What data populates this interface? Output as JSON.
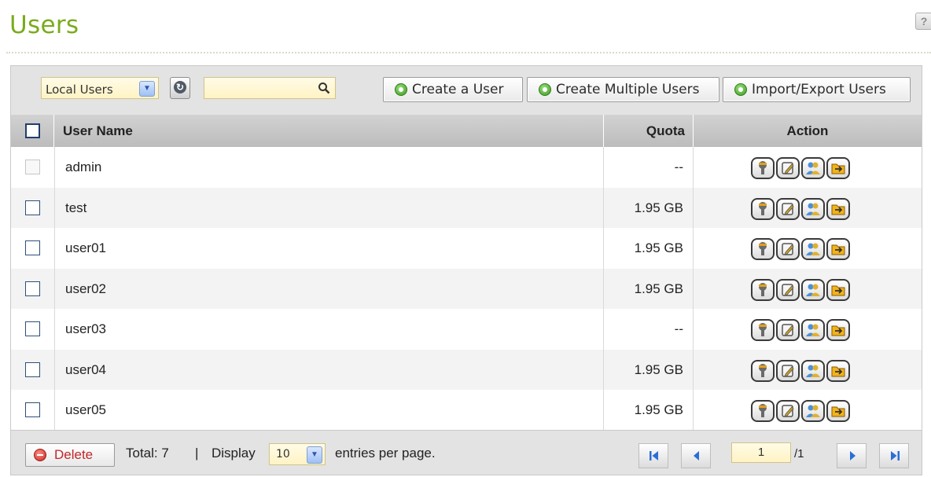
{
  "page": {
    "title": "Users",
    "help_icon": "?"
  },
  "toolbar": {
    "user_type_select": "Local Users",
    "refresh_icon": "refresh-icon",
    "search_placeholder": "",
    "create_user_label": "Create a User",
    "create_multiple_label": "Create Multiple Users",
    "import_export_label": "Import/Export Users"
  },
  "table": {
    "columns": {
      "name": "User Name",
      "quota": "Quota",
      "action": "Action"
    },
    "rows": [
      {
        "name": "admin",
        "quota": "--",
        "checkbox_enabled": false
      },
      {
        "name": "test",
        "quota": "1.95 GB",
        "checkbox_enabled": true
      },
      {
        "name": "user01",
        "quota": "1.95 GB",
        "checkbox_enabled": true
      },
      {
        "name": "user02",
        "quota": "1.95 GB",
        "checkbox_enabled": true
      },
      {
        "name": "user03",
        "quota": "--",
        "checkbox_enabled": true
      },
      {
        "name": "user04",
        "quota": "1.95 GB",
        "checkbox_enabled": true
      },
      {
        "name": "user05",
        "quota": "1.95 GB",
        "checkbox_enabled": true
      }
    ],
    "action_icons": [
      "password-key-icon",
      "edit-profile-icon",
      "user-group-icon",
      "edit-folder-permission-icon"
    ]
  },
  "footer": {
    "delete_label": "Delete",
    "total_label": "Total:",
    "total_count": "7",
    "separator": "|",
    "display_label": "Display",
    "page_size": "10",
    "per_page_label": "entries per page.",
    "current_page": "1",
    "total_pages": "/1"
  },
  "colors": {
    "title_green": "#7aab1d",
    "header_gray": "#c4c4c4",
    "input_yellow": "#fff3c4",
    "delete_red": "#c0262a",
    "nav_blue": "#2a6fd6"
  }
}
